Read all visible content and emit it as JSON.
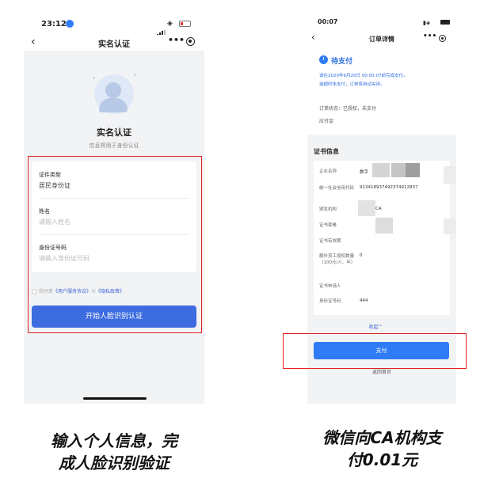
{
  "colors": {
    "highlight_box": "#e02020",
    "primary_button": "#3d6ce0",
    "pay_button": "#2f7cf6",
    "link": "#3a63d8"
  },
  "left_phone": {
    "status_time": "23:12",
    "nav_title": "实名认证",
    "heading": "实名认证",
    "subheading": "信息将用于身份认证",
    "form": {
      "id_type_label": "证件类型",
      "id_type_value": "居民身份证",
      "name_label": "姓名",
      "name_placeholder": "请输入姓名",
      "id_number_label": "身份证号码",
      "id_number_placeholder": "请输入身份证号码"
    },
    "agreement": {
      "prefix": "我同意",
      "user_agreement": "《用户服务协议》",
      "and": "与",
      "privacy": "《隐私政策》"
    },
    "start_button": "开始人脸识别认证"
  },
  "right_phone": {
    "status_time": "00:07",
    "nav_title": "订单详情",
    "pay_status": "待支付",
    "hint_line1": "请在2020年6月20日 00:00:07前完成支付。",
    "hint_line2": "逾超时未支付，订单将自动关闭。",
    "order_status_label": "订单状态：",
    "order_status_value": "已授权，未支付",
    "amount_label": "应付金",
    "cert_section_title": "证书信息",
    "cert_rows": [
      {
        "key": "企业名称",
        "value": "数字"
      },
      {
        "key": "统一社会信用代码",
        "value": "913418937492374912837"
      },
      {
        "key": "颁发机构",
        "value": "CA"
      },
      {
        "key": "证书套餐",
        "value": ""
      },
      {
        "key": "证书有效期",
        "value": ""
      },
      {
        "key": "额外员工授权数量（100元/人、年）",
        "value": "0"
      },
      {
        "key": "证书申请人",
        "value": ""
      },
      {
        "key": "身份证号码",
        "value": "444"
      }
    ],
    "collapse_link": "收起^",
    "pay_button": "支付",
    "back_home": "返回首页"
  },
  "captions": {
    "left_line1": "输入个人信息，完",
    "left_line2": "成人脸识别验证",
    "right_line1": "微信向CA机构支",
    "right_line2": "付0.01元"
  }
}
